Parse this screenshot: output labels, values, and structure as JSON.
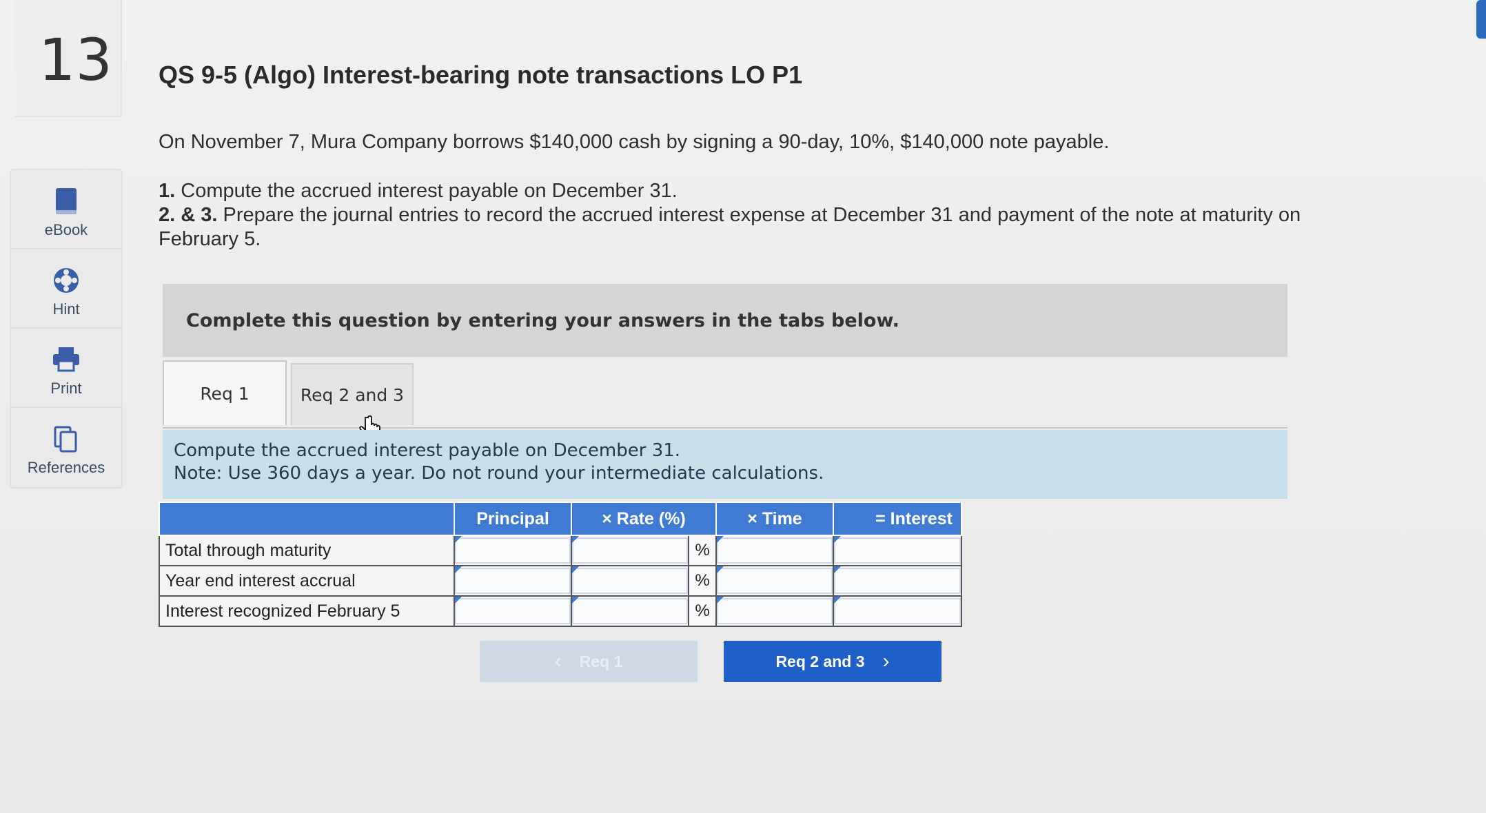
{
  "question": {
    "number": "13",
    "title": "QS 9-5 (Algo) Interest-bearing note transactions LO P1"
  },
  "sidebar": {
    "items": [
      {
        "label": "eBook",
        "icon": "book-icon"
      },
      {
        "label": "Hint",
        "icon": "lifebuoy-icon"
      },
      {
        "label": "Print",
        "icon": "printer-icon"
      },
      {
        "label": "References",
        "icon": "copy-icon"
      }
    ]
  },
  "intro": "On November 7, Mura Company borrows $140,000 cash by signing a 90-day, 10%, $140,000 note payable.",
  "requirements": [
    {
      "num": "1.",
      "text": " Compute the accrued interest payable on December 31."
    },
    {
      "num": "2. & 3.",
      "text": " Prepare the journal entries to record the accrued interest expense at December 31 and payment of the note at maturity on February 5."
    }
  ],
  "instruction": "Complete this question by entering your answers in the tabs below.",
  "tabs": {
    "active": "Req 1",
    "other": "Req 2 and 3"
  },
  "panel": {
    "line1": "Compute the accrued interest payable on December 31.",
    "line2": "Note: Use 360 days a year. Do not round your intermediate calculations."
  },
  "table": {
    "headers": [
      "Principal",
      "× Rate (%)",
      "× Time",
      "= Interest"
    ],
    "rows": [
      "Total through maturity",
      "Year end interest accrual",
      "Interest recognized February 5"
    ],
    "percent_symbol": "%"
  },
  "nav": {
    "prev": "Req 1",
    "next": "Req 2 and 3"
  },
  "colors": {
    "header_blue": "#3f7bd2",
    "button_blue": "#1f5fc9",
    "panel_blue": "#c6dfe8"
  }
}
